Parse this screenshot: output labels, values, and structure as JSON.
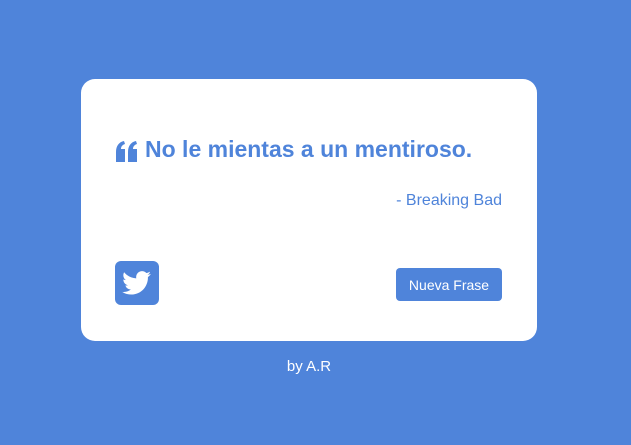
{
  "quote": {
    "text": "No le mientas a un mentiroso.",
    "author": "- Breaking Bad",
    "icon": "quote-left-icon"
  },
  "actions": {
    "tweet_icon": "twitter-icon",
    "new_quote_label": "Nueva Frase"
  },
  "footer": {
    "credit": "by A.R"
  },
  "colors": {
    "background": "#4f84da",
    "card": "#ffffff",
    "accent": "#4f84da"
  }
}
